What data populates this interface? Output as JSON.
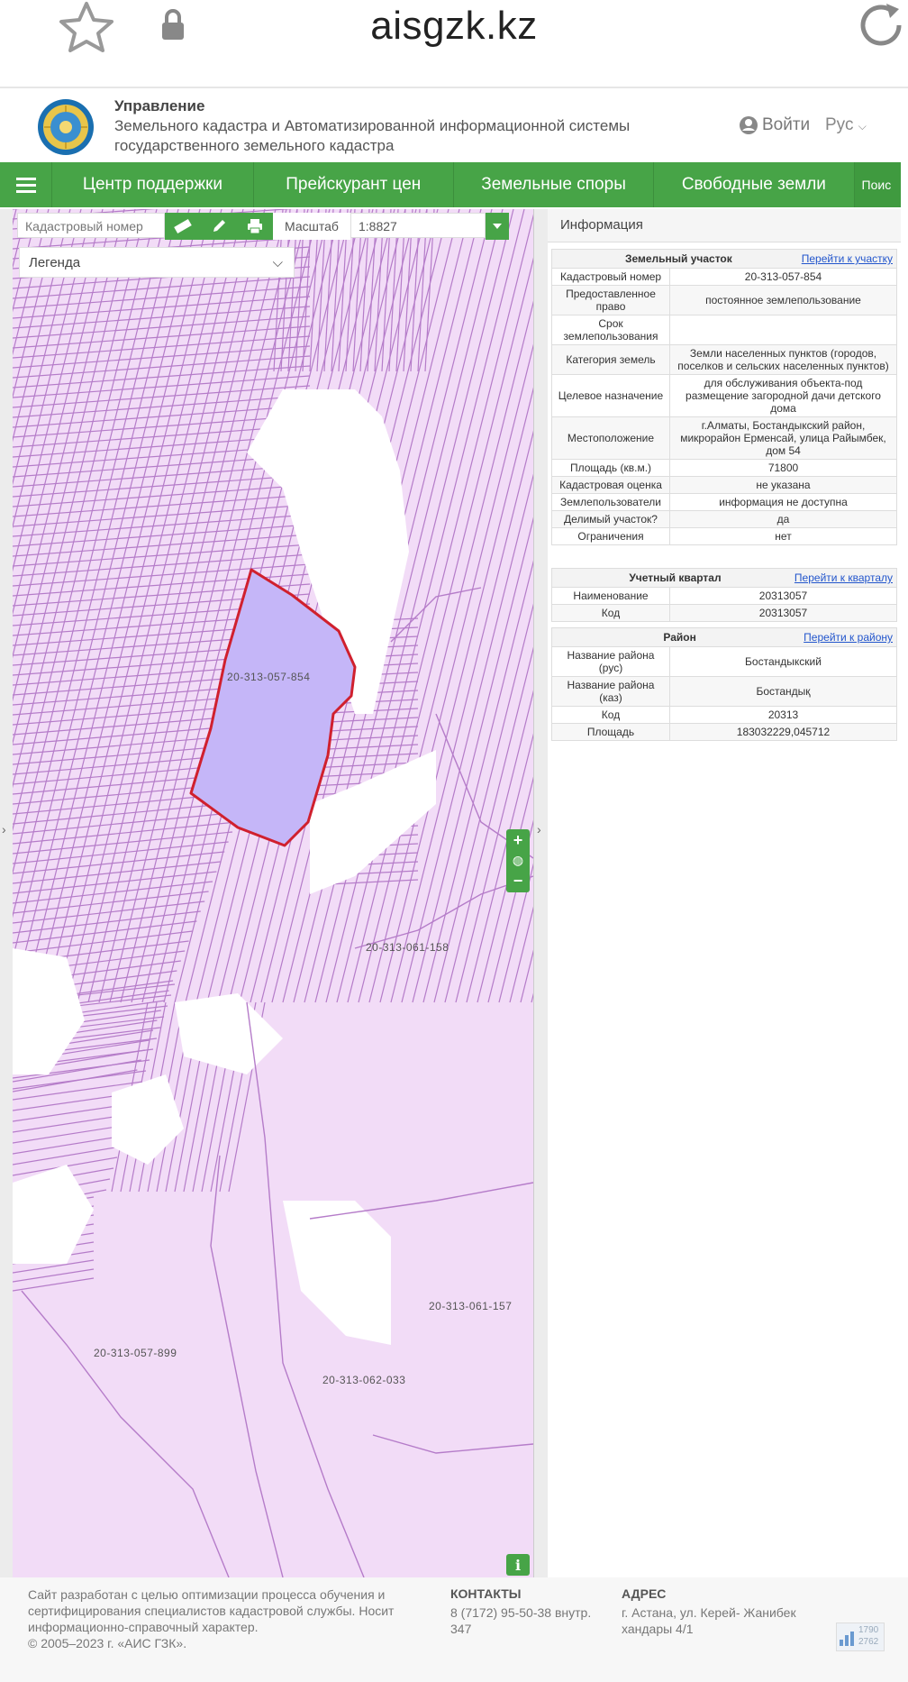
{
  "browser": {
    "url": "aisgzk.kz"
  },
  "header": {
    "org_line1": "Управление",
    "org_line2": "Земельного кадастра и Автоматизированной информационной системы",
    "org_line3": "государственного земельного кадастра",
    "login": "Войти",
    "lang": "Рус"
  },
  "nav": {
    "items": [
      "Центр поддержки",
      "Прейскурант цен",
      "Земельные споры",
      "Свободные земли"
    ],
    "search": "Поис"
  },
  "toolbar": {
    "cadastral_placeholder": "Кадастровый номер",
    "scale_label": "Масштаб",
    "scale_value": "1:8827",
    "legend": "Легенда"
  },
  "map": {
    "selected_parcel": "20-313-057-854",
    "labels": [
      "20-313-061-158",
      "20-313-061-157",
      "20-313-057-899",
      "20-313-062-033"
    ]
  },
  "panel": {
    "title": "Информация",
    "parcel": {
      "heading": "Земельный участок",
      "link": "Перейти к участку",
      "rows": [
        [
          "Кадастровый номер",
          "20-313-057-854"
        ],
        [
          "Предоставленное право",
          "постоянное землепользование"
        ],
        [
          "Срок землепользования",
          ""
        ],
        [
          "Категория земель",
          "Земли населенных пунктов (городов, поселков и сельских населенных пунктов)"
        ],
        [
          "Целевое назначение",
          "для обслуживания объекта-под размещение загородной дачи детского дома"
        ],
        [
          "Местоположение",
          "г.Алматы, Бостандыкский район, микрорайон Ерменсай, улица Райымбек, дом 54"
        ],
        [
          "Площадь (кв.м.)",
          "71800"
        ],
        [
          "Кадастровая оценка",
          "не указана"
        ],
        [
          "Землепользователи",
          "информация не доступна"
        ],
        [
          "Делимый участок?",
          "да"
        ],
        [
          "Ограничения",
          "нет"
        ]
      ]
    },
    "quarter": {
      "heading": "Учетный квартал",
      "link": "Перейти к кварталу",
      "rows": [
        [
          "Наименование",
          "20313057"
        ],
        [
          "Код",
          "20313057"
        ]
      ]
    },
    "district": {
      "heading": "Район",
      "link": "Перейти к району",
      "rows": [
        [
          "Название района (рус)",
          "Бостандыкский"
        ],
        [
          "Название района (каз)",
          "Бостандық"
        ],
        [
          "Код",
          "20313"
        ],
        [
          "Площадь",
          "183032229,045712"
        ]
      ]
    }
  },
  "footer": {
    "about": "Сайт разработан с целью оптимизации процесса обучения и сертифицирования специалистов кадастровой службы. Носит информационно-справочный характер.",
    "copyright": "© 2005–2023 г. «АИС ГЗК».",
    "contacts_heading": "КОНТАКТЫ",
    "contacts": "8 (7172) 95-50-38 внутр. 347",
    "address_heading": "АДРЕС",
    "address": "г. Астана, ул. Керей- Жанибек хандары 4/1",
    "counter": [
      "1790",
      "2762"
    ]
  },
  "colors": {
    "green": "#47a447",
    "map_bg": "#f2dcf7",
    "parcel_line": "#b57cc9",
    "selected_fill": "#c5b6f8",
    "selected_line": "#d0202e"
  }
}
